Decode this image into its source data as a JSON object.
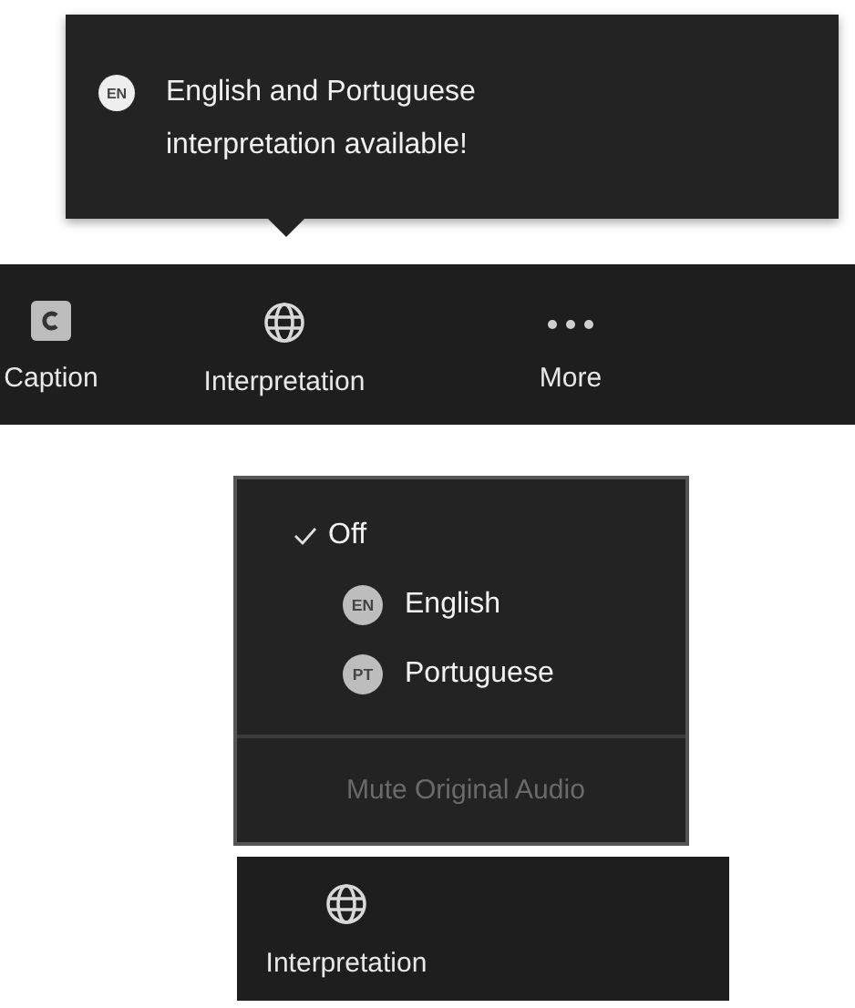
{
  "notification": {
    "badge": "EN",
    "message": "English and Portuguese interpretation available!"
  },
  "toolbar": {
    "buttons": [
      {
        "kind": "caption",
        "label": "Caption"
      },
      {
        "kind": "globe",
        "label": "Interpretation"
      },
      {
        "kind": "more",
        "label": "More"
      }
    ]
  },
  "interpretation_menu": {
    "options": [
      {
        "label": "Off",
        "selected": true
      },
      {
        "badge": "EN",
        "label": "English",
        "selected": false
      },
      {
        "badge": "PT",
        "label": "Portuguese",
        "selected": false
      }
    ],
    "actions": [
      {
        "label": "Mute Original Audio",
        "disabled": true
      }
    ]
  },
  "bottom_toolbar": {
    "buttons": [
      {
        "kind": "globe",
        "label": "Interpretation"
      }
    ]
  }
}
